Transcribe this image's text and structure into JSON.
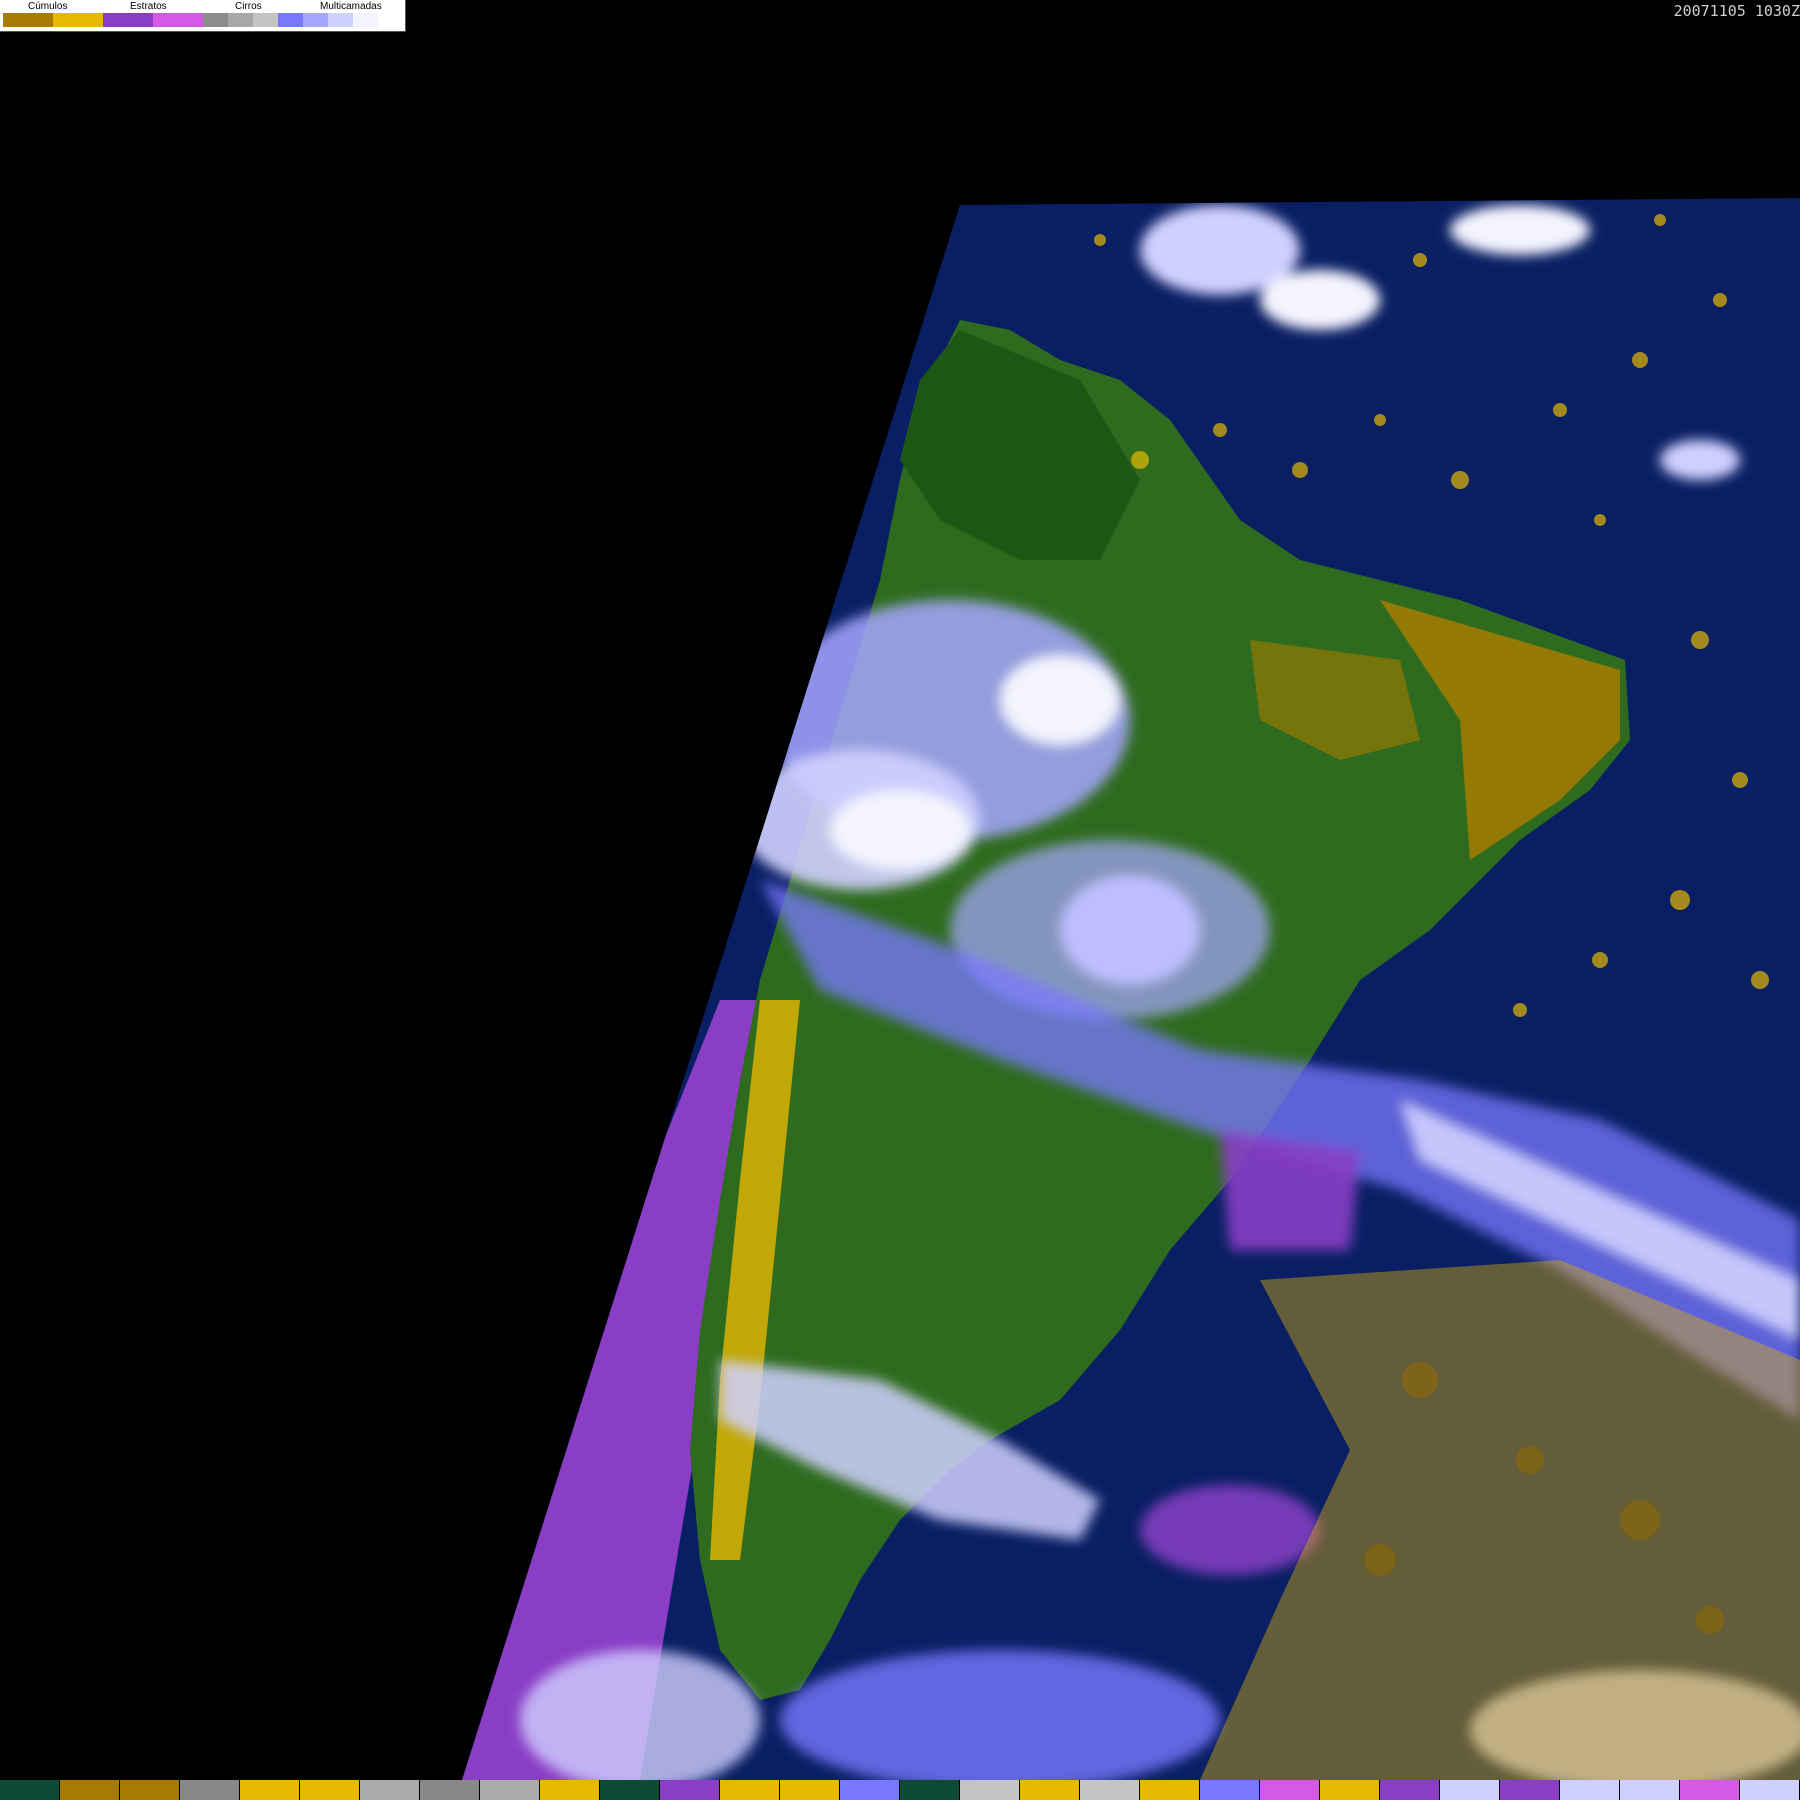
{
  "legend": {
    "groups": [
      {
        "label": "Cúmulos",
        "swatches": [
          "#a67c00",
          "#e6b800"
        ]
      },
      {
        "label": "Estratos",
        "swatches": [
          "#8a3ec6",
          "#d45ae6"
        ]
      },
      {
        "label": "Cirros",
        "swatches": [
          "#8c8c8c",
          "#a8a8a8",
          "#c4c4c4"
        ]
      },
      {
        "label": "Multicamadas",
        "swatches": [
          "#7878ff",
          "#a6a6ff",
          "#d0d0ff",
          "#f4f4ff"
        ]
      }
    ]
  },
  "timestamp": "20071105 1030Z",
  "colors": {
    "background": "#000000",
    "ocean": "#0a1f63",
    "land": "#2f6b1e",
    "land_dark": "#1e5616"
  },
  "bottom_strip": [
    "#0e4a34",
    "#a67c00",
    "#a67c00",
    "#888888",
    "#e6b800",
    "#e6b800",
    "#aaaaaa",
    "#888888",
    "#aaaaaa",
    "#e6b800",
    "#0e4a34",
    "#8a3ec6",
    "#e6b800",
    "#e6b800",
    "#7878ff",
    "#0e4a34",
    "#c4c4c4",
    "#e6b800",
    "#c4c4c4",
    "#e6b800",
    "#7878ff",
    "#d45ae6",
    "#e6b800",
    "#8a3ec6",
    "#d0d0ff",
    "#8a3ec6",
    "#d0d0ff",
    "#d0d0ff",
    "#d45ae6",
    "#d0d0ff"
  ]
}
